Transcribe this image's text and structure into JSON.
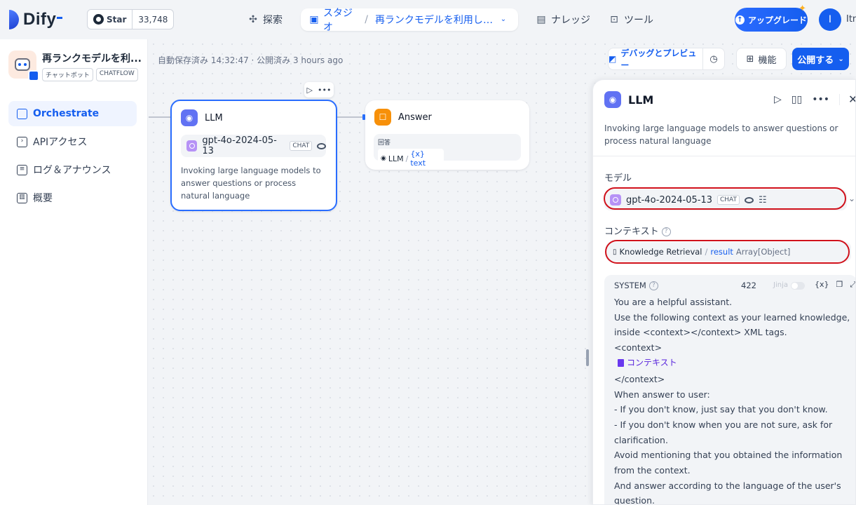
{
  "brand": {
    "name": "Dify"
  },
  "github": {
    "star_label": "Star",
    "count": "33,748"
  },
  "nav": {
    "explore": "探索",
    "studio": "スタジオ",
    "separator": "/",
    "current_app": "再ランクモデルを利用したテス...",
    "knowledge": "ナレッジ",
    "tools": "ツール"
  },
  "upgrade_label": "アップグレード",
  "user": {
    "initial": "I",
    "name": "Itn"
  },
  "app": {
    "name": "再ランクモデルを利...",
    "tags": [
      "チャットボット",
      "CHATFLOW"
    ]
  },
  "sidebar": {
    "items": [
      {
        "label": "Orchestrate",
        "icon": "orchestrate-icon",
        "active": true
      },
      {
        "label": "APIアクセス",
        "icon": "terminal-icon",
        "active": false
      },
      {
        "label": "ログ＆アナウンス",
        "icon": "log-icon",
        "active": false
      },
      {
        "label": "概要",
        "icon": "chart-icon",
        "active": false
      }
    ]
  },
  "toolbar": {
    "save_status": "自動保存済み 14:32:47 · 公開済み 3 hours ago",
    "debug_label": "デバッグとプレビュー",
    "features_label": "機能",
    "publish_label": "公開する"
  },
  "nodes": {
    "llm": {
      "title": "LLM",
      "model": "gpt-4o-2024-05-13",
      "model_tag": "CHAT",
      "description": "Invoking large language models to answer questions or process natural language"
    },
    "answer": {
      "title": "Answer",
      "field_label": "回答",
      "ref_node": "LLM",
      "ref_separator": "/",
      "ref_var": "{x} text"
    }
  },
  "panel": {
    "title": "LLM",
    "description": "Invoking large language models to answer questions or process natural language",
    "model_label": "モデル",
    "model": "gpt-4o-2024-05-13",
    "model_tag": "CHAT",
    "context_label": "コンテキスト",
    "context": {
      "node": "Knowledge Retrieval",
      "separator": "/",
      "var": "result",
      "type": "Array[Object]"
    },
    "system": {
      "label": "SYSTEM",
      "count": "422",
      "jinja": "Jinja",
      "var_icon": "{x}",
      "lines": [
        "You are a helpful assistant.",
        "Use the following context as your learned knowledge, inside <context></context> XML tags.",
        "<context>",
        "",
        "</context>",
        "When answer to user:",
        "- If you don't know, just say that you don't know.",
        "- If you don't know when you are not sure, ask for clarification.",
        "Avoid mentioning that you obtained the information from the context.",
        "And answer according to the language of the user's question."
      ],
      "context_chip": "コンテキスト"
    }
  },
  "colors": {
    "accent": "#155eef",
    "highlight": "#d0111b",
    "llm_badge": "#6172f3",
    "answer_badge": "#f79009"
  }
}
